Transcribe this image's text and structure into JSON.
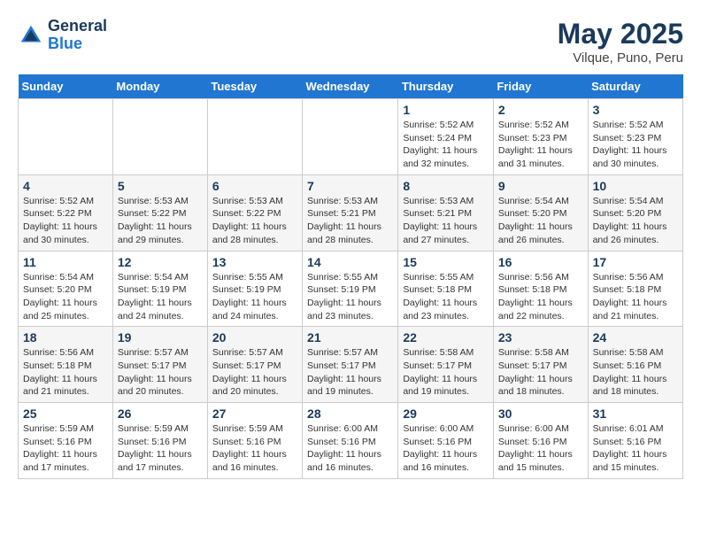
{
  "header": {
    "logo_line1": "General",
    "logo_line2": "Blue",
    "title": "May 2025",
    "location": "Vilque, Puno, Peru"
  },
  "days_of_week": [
    "Sunday",
    "Monday",
    "Tuesday",
    "Wednesday",
    "Thursday",
    "Friday",
    "Saturday"
  ],
  "weeks": [
    [
      {
        "day": "",
        "info": ""
      },
      {
        "day": "",
        "info": ""
      },
      {
        "day": "",
        "info": ""
      },
      {
        "day": "",
        "info": ""
      },
      {
        "day": "1",
        "info": "Sunrise: 5:52 AM\nSunset: 5:24 PM\nDaylight: 11 hours\nand 32 minutes."
      },
      {
        "day": "2",
        "info": "Sunrise: 5:52 AM\nSunset: 5:23 PM\nDaylight: 11 hours\nand 31 minutes."
      },
      {
        "day": "3",
        "info": "Sunrise: 5:52 AM\nSunset: 5:23 PM\nDaylight: 11 hours\nand 30 minutes."
      }
    ],
    [
      {
        "day": "4",
        "info": "Sunrise: 5:52 AM\nSunset: 5:22 PM\nDaylight: 11 hours\nand 30 minutes."
      },
      {
        "day": "5",
        "info": "Sunrise: 5:53 AM\nSunset: 5:22 PM\nDaylight: 11 hours\nand 29 minutes."
      },
      {
        "day": "6",
        "info": "Sunrise: 5:53 AM\nSunset: 5:22 PM\nDaylight: 11 hours\nand 28 minutes."
      },
      {
        "day": "7",
        "info": "Sunrise: 5:53 AM\nSunset: 5:21 PM\nDaylight: 11 hours\nand 28 minutes."
      },
      {
        "day": "8",
        "info": "Sunrise: 5:53 AM\nSunset: 5:21 PM\nDaylight: 11 hours\nand 27 minutes."
      },
      {
        "day": "9",
        "info": "Sunrise: 5:54 AM\nSunset: 5:20 PM\nDaylight: 11 hours\nand 26 minutes."
      },
      {
        "day": "10",
        "info": "Sunrise: 5:54 AM\nSunset: 5:20 PM\nDaylight: 11 hours\nand 26 minutes."
      }
    ],
    [
      {
        "day": "11",
        "info": "Sunrise: 5:54 AM\nSunset: 5:20 PM\nDaylight: 11 hours\nand 25 minutes."
      },
      {
        "day": "12",
        "info": "Sunrise: 5:54 AM\nSunset: 5:19 PM\nDaylight: 11 hours\nand 24 minutes."
      },
      {
        "day": "13",
        "info": "Sunrise: 5:55 AM\nSunset: 5:19 PM\nDaylight: 11 hours\nand 24 minutes."
      },
      {
        "day": "14",
        "info": "Sunrise: 5:55 AM\nSunset: 5:19 PM\nDaylight: 11 hours\nand 23 minutes."
      },
      {
        "day": "15",
        "info": "Sunrise: 5:55 AM\nSunset: 5:18 PM\nDaylight: 11 hours\nand 23 minutes."
      },
      {
        "day": "16",
        "info": "Sunrise: 5:56 AM\nSunset: 5:18 PM\nDaylight: 11 hours\nand 22 minutes."
      },
      {
        "day": "17",
        "info": "Sunrise: 5:56 AM\nSunset: 5:18 PM\nDaylight: 11 hours\nand 21 minutes."
      }
    ],
    [
      {
        "day": "18",
        "info": "Sunrise: 5:56 AM\nSunset: 5:18 PM\nDaylight: 11 hours\nand 21 minutes."
      },
      {
        "day": "19",
        "info": "Sunrise: 5:57 AM\nSunset: 5:17 PM\nDaylight: 11 hours\nand 20 minutes."
      },
      {
        "day": "20",
        "info": "Sunrise: 5:57 AM\nSunset: 5:17 PM\nDaylight: 11 hours\nand 20 minutes."
      },
      {
        "day": "21",
        "info": "Sunrise: 5:57 AM\nSunset: 5:17 PM\nDaylight: 11 hours\nand 19 minutes."
      },
      {
        "day": "22",
        "info": "Sunrise: 5:58 AM\nSunset: 5:17 PM\nDaylight: 11 hours\nand 19 minutes."
      },
      {
        "day": "23",
        "info": "Sunrise: 5:58 AM\nSunset: 5:17 PM\nDaylight: 11 hours\nand 18 minutes."
      },
      {
        "day": "24",
        "info": "Sunrise: 5:58 AM\nSunset: 5:16 PM\nDaylight: 11 hours\nand 18 minutes."
      }
    ],
    [
      {
        "day": "25",
        "info": "Sunrise: 5:59 AM\nSunset: 5:16 PM\nDaylight: 11 hours\nand 17 minutes."
      },
      {
        "day": "26",
        "info": "Sunrise: 5:59 AM\nSunset: 5:16 PM\nDaylight: 11 hours\nand 17 minutes."
      },
      {
        "day": "27",
        "info": "Sunrise: 5:59 AM\nSunset: 5:16 PM\nDaylight: 11 hours\nand 16 minutes."
      },
      {
        "day": "28",
        "info": "Sunrise: 6:00 AM\nSunset: 5:16 PM\nDaylight: 11 hours\nand 16 minutes."
      },
      {
        "day": "29",
        "info": "Sunrise: 6:00 AM\nSunset: 5:16 PM\nDaylight: 11 hours\nand 16 minutes."
      },
      {
        "day": "30",
        "info": "Sunrise: 6:00 AM\nSunset: 5:16 PM\nDaylight: 11 hours\nand 15 minutes."
      },
      {
        "day": "31",
        "info": "Sunrise: 6:01 AM\nSunset: 5:16 PM\nDaylight: 11 hours\nand 15 minutes."
      }
    ]
  ]
}
